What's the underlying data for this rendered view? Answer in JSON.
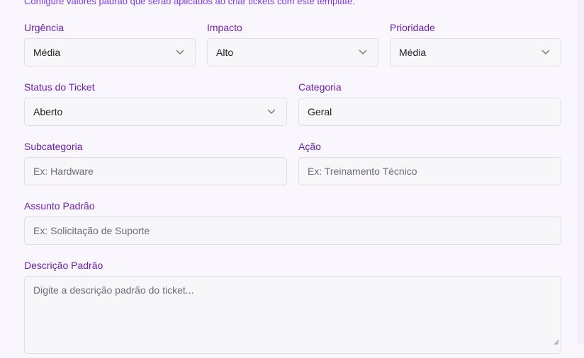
{
  "header": {
    "subtitle": "Configure valores padrão que serão aplicados ao criar tickets com este template."
  },
  "fields": {
    "urgencia": {
      "label": "Urgência",
      "value": "Média"
    },
    "impacto": {
      "label": "Impacto",
      "value": "Alto"
    },
    "prioridade": {
      "label": "Prioridade",
      "value": "Média"
    },
    "status": {
      "label": "Status do Ticket",
      "value": "Aberto"
    },
    "categoria": {
      "label": "Categoria",
      "value": "Geral"
    },
    "subcategoria": {
      "label": "Subcategoria",
      "placeholder": "Ex: Hardware"
    },
    "acao": {
      "label": "Ação",
      "placeholder": "Ex: Treinamento Técnico"
    },
    "assunto": {
      "label": "Assunto Padrão",
      "placeholder": "Ex: Solicitação de Suporte"
    },
    "descricao": {
      "label": "Descrição Padrão",
      "placeholder": "Digite a descrição padrão do ticket..."
    }
  },
  "icons": {
    "select_arrow": "chevron-down-icon",
    "resize_handle": "resize-handle-icon"
  },
  "colors": {
    "label": "#6b21a8",
    "subtitle": "#7c3aed",
    "background": "#faf6fe",
    "field_background": "#f7f6f9",
    "field_border": "#e0dde6"
  }
}
